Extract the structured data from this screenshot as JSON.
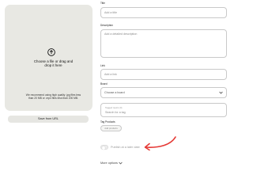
{
  "upload": {
    "icon": "upload-arrow-icon",
    "text_line1": "Choose a file or drag and",
    "text_line2": "drop it here",
    "recommendation_line1": "We recommend using high quality .jpg files less",
    "recommendation_line2": "than 20 MB or .mp4 files less than 200 MB."
  },
  "save_from_url": {
    "label": "Save from URL"
  },
  "form": {
    "title": {
      "label": "Title",
      "placeholder": "Add a title"
    },
    "description": {
      "label": "Description",
      "placeholder": "Add a detailed description"
    },
    "link": {
      "label": "Link",
      "placeholder": "Add a link"
    },
    "board": {
      "label": "Board",
      "value": "Choose a board",
      "icon": "chevron-down-icon"
    },
    "tags": {
      "small_label": "Tagged topics (0)",
      "placeholder": "Search for a tag"
    },
    "products": {
      "label": "Tag Products",
      "button": "Add products"
    },
    "publish_later": {
      "label": "Publish at a later date",
      "enabled": false
    },
    "more_options": {
      "label": "More options",
      "icon": "chevron-down-icon"
    }
  },
  "annotation": {
    "color": "#e53935",
    "icon": "arrow-pointing-left"
  }
}
